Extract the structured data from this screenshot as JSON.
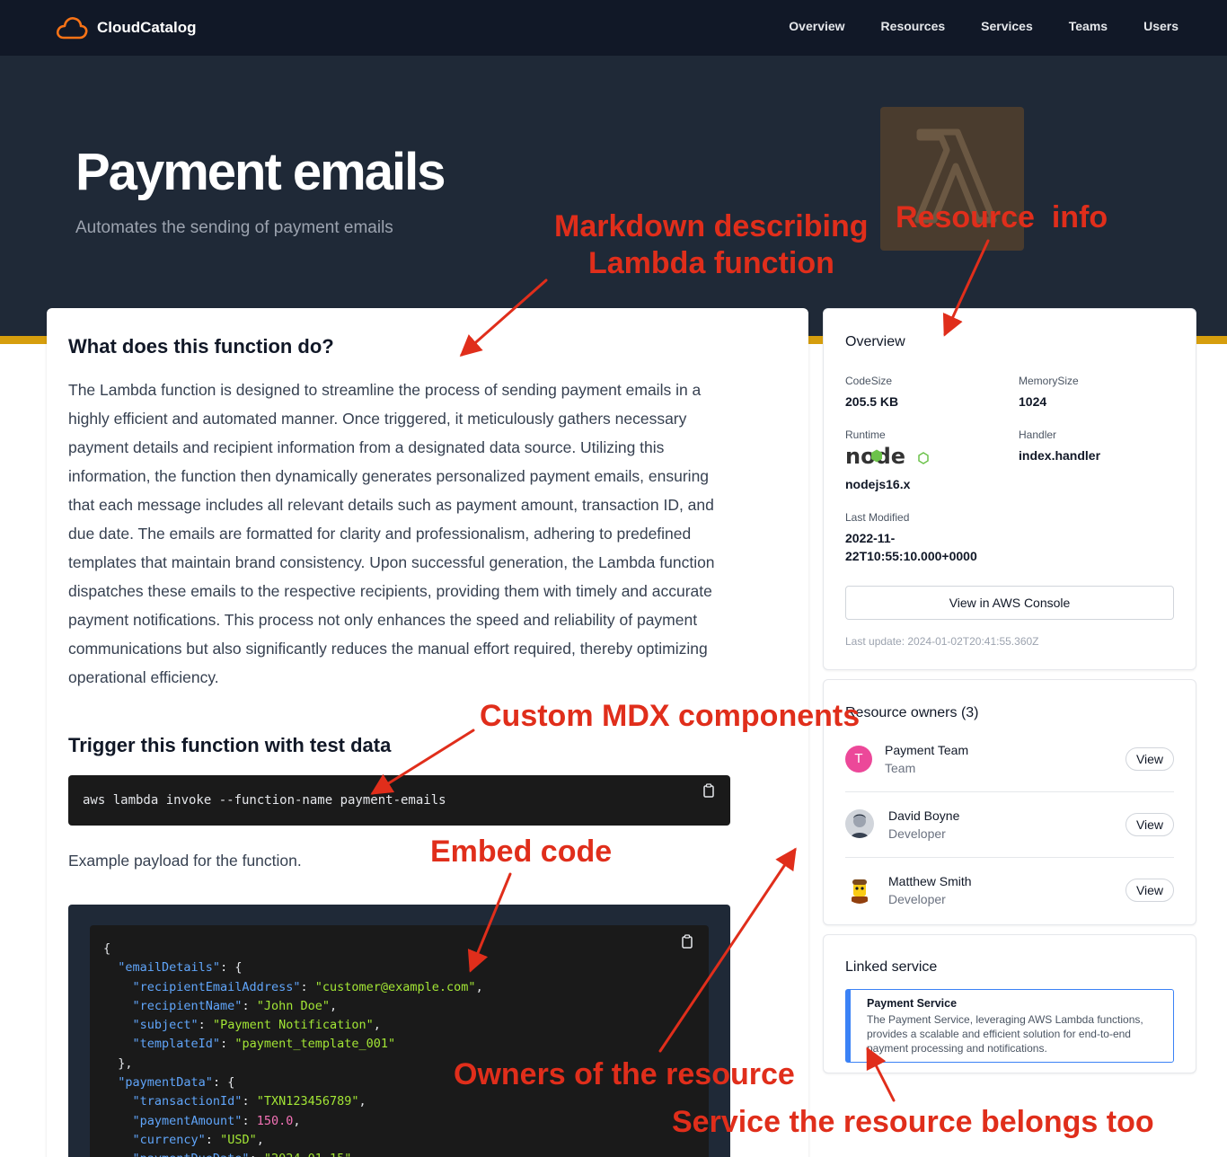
{
  "nav": {
    "brand": "CloudCatalog",
    "links": [
      "Overview",
      "Resources",
      "Services",
      "Teams",
      "Users"
    ]
  },
  "hero": {
    "title": "Payment emails",
    "subtitle": "Automates the sending of payment emails"
  },
  "main": {
    "heading1": "What does this function do?",
    "description": "The Lambda function is designed to streamline the process of sending payment emails in a highly efficient and automated manner. Once triggered, it meticulously gathers necessary payment details and recipient information from a designated data source. Utilizing this information, the function then dynamically generates personalized payment emails, ensuring that each message includes all relevant details such as payment amount, transaction ID, and due date. The emails are formatted for clarity and professionalism, adhering to predefined templates that maintain brand consistency. Upon successful generation, the Lambda function dispatches these emails to the respective recipients, providing them with timely and accurate payment notifications. This process not only enhances the speed and reliability of payment communications but also significantly reduces the manual effort required, thereby optimizing operational efficiency.",
    "heading2": "Trigger this function with test data",
    "command": "aws lambda invoke --function-name payment-emails",
    "payload_label": "Example payload for the function.",
    "payload": {
      "emailDetails": {
        "recipientEmailAddress": "customer@example.com",
        "recipientName": "John Doe",
        "subject": "Payment Notification",
        "templateId": "payment_template_001"
      },
      "paymentData": {
        "transactionId": "TXN123456789",
        "paymentAmount": "150.0",
        "currency": "USD",
        "paymentDueDate": "2024-01-15"
      }
    }
  },
  "overview": {
    "title": "Overview",
    "code_size_label": "CodeSize",
    "code_size": "205.5 KB",
    "memory_size_label": "MemorySize",
    "memory_size": "1024",
    "runtime_label": "Runtime",
    "runtime_logo_text": "node",
    "runtime": "nodejs16.x",
    "handler_label": "Handler",
    "handler": "index.handler",
    "last_modified_label": "Last Modified",
    "last_modified_line1": "2022-11-",
    "last_modified_line2": "22T10:55:10.000+0000",
    "console_button": "View in AWS Console",
    "last_update": "Last update: 2024-01-02T20:41:55.360Z"
  },
  "owners": {
    "title": "Resource owners (3)",
    "items": [
      {
        "name": "Payment Team",
        "role": "Team",
        "initial": "T",
        "button": "View"
      },
      {
        "name": "David Boyne",
        "role": "Developer",
        "button": "View"
      },
      {
        "name": "Matthew Smith",
        "role": "Developer",
        "button": "View"
      }
    ]
  },
  "linked": {
    "title": "Linked service",
    "service_name": "Payment Service",
    "service_description": "The Payment Service, leveraging AWS Lambda functions, provides a scalable and efficient solution for end-to-end payment processing and notifications."
  },
  "annotations": {
    "markdown_line1": "Markdown describing",
    "markdown_line2": "Lambda function",
    "resource_info": "Resource  info",
    "mdx": "Custom MDX components",
    "embed": "Embed code",
    "owners": "Owners of the resource",
    "service": "Service the resource belongs too"
  },
  "colors": {
    "nav_bg": "#111827",
    "hero_bg": "#1f2937",
    "accent": "#d69e0d",
    "annotation": "#e02e1b",
    "link_blue": "#3b82f6",
    "team_avatar": "#ec4899"
  },
  "icons": [
    "cloud-icon",
    "lambda-icon",
    "copy-icon",
    "nodejs-logo"
  ]
}
